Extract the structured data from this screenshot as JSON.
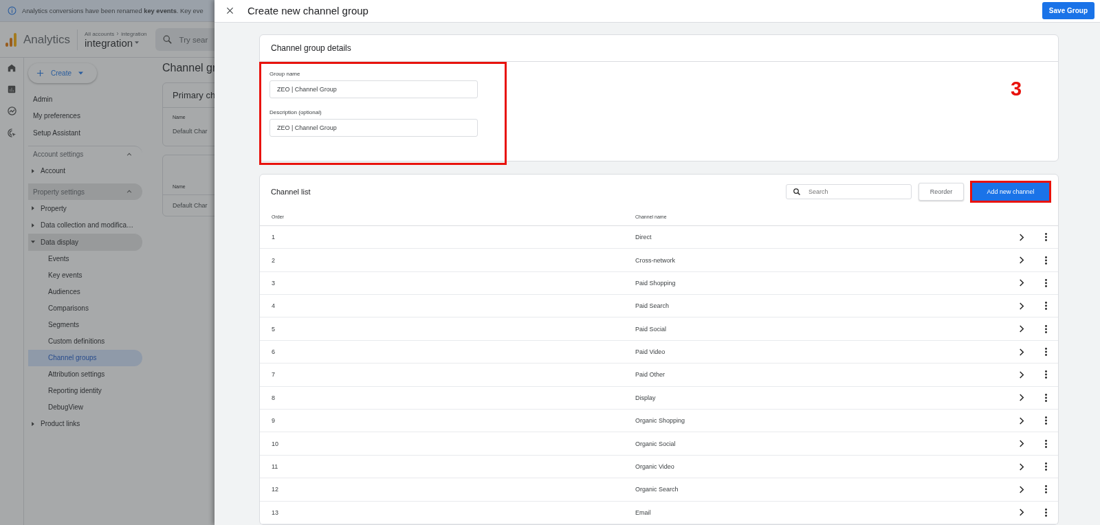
{
  "banner": {
    "text": "Analytics conversions have been renamed **key events**. Key eve"
  },
  "app": {
    "name": "Analytics",
    "breadcrumb": [
      "All accounts",
      "integration"
    ],
    "property": "integration",
    "search_placeholder": "Try sear"
  },
  "rail": [
    {
      "kind": "home"
    },
    {
      "kind": "reports"
    },
    {
      "kind": "explore"
    },
    {
      "kind": "advertising"
    }
  ],
  "create_button": "Create",
  "nav": {
    "links": [
      "Admin",
      "My preferences",
      "Setup Assistant"
    ],
    "sections": [
      {
        "title": "Account settings",
        "expanded": true,
        "selected": false,
        "items": [
          {
            "label": "Account",
            "expanded": false,
            "selected": false
          }
        ]
      },
      {
        "title": "Property settings",
        "expanded": true,
        "selected": true,
        "items": [
          {
            "label": "Property",
            "expanded": false,
            "selected": false
          },
          {
            "label": "Data collection and modifica…",
            "expanded": false,
            "selected": false
          },
          {
            "label": "Data display",
            "expanded": true,
            "selected": true,
            "children": [
              {
                "label": "Events",
                "selected": false
              },
              {
                "label": "Key events",
                "selected": false
              },
              {
                "label": "Audiences",
                "selected": false
              },
              {
                "label": "Comparisons",
                "selected": false
              },
              {
                "label": "Segments",
                "selected": false
              },
              {
                "label": "Custom definitions",
                "selected": false
              },
              {
                "label": "Channel groups",
                "selected": true
              },
              {
                "label": "Attribution settings",
                "selected": false
              },
              {
                "label": "Reporting identity",
                "selected": false
              },
              {
                "label": "DebugView",
                "selected": false
              }
            ]
          },
          {
            "label": "Product links",
            "expanded": false,
            "selected": false
          }
        ]
      }
    ]
  },
  "main": {
    "title": "Channel gr",
    "cards": [
      {
        "title": "Primary ch",
        "column": "Name",
        "row": "Default Char"
      },
      {
        "column": "Name",
        "row": "Default Char"
      }
    ]
  },
  "drawer": {
    "title": "Create new channel group",
    "save_button": "Save Group",
    "details": {
      "title": "Channel group details",
      "highlighted": true,
      "fields": [
        {
          "label": "Group name",
          "value": "ZEO | Channel Group"
        },
        {
          "label": "Description (optional)",
          "value": "ZEO | Channel Group"
        }
      ]
    },
    "annotation": "3",
    "channel_list": {
      "title": "Channel list",
      "search_placeholder": "Search",
      "reorder_button": "Reorder",
      "add_button": {
        "label": "Add new channel",
        "highlighted": true
      },
      "columns": [
        "Order",
        "Channel name"
      ],
      "rows": [
        {
          "order": "1",
          "name": "Direct"
        },
        {
          "order": "2",
          "name": "Cross-network"
        },
        {
          "order": "3",
          "name": "Paid Shopping"
        },
        {
          "order": "4",
          "name": "Paid Search"
        },
        {
          "order": "5",
          "name": "Paid Social"
        },
        {
          "order": "6",
          "name": "Paid Video"
        },
        {
          "order": "7",
          "name": "Paid Other"
        },
        {
          "order": "8",
          "name": "Display"
        },
        {
          "order": "9",
          "name": "Organic Shopping"
        },
        {
          "order": "10",
          "name": "Organic Social"
        },
        {
          "order": "11",
          "name": "Organic Video"
        },
        {
          "order": "12",
          "name": "Organic Search"
        },
        {
          "order": "13",
          "name": "Email"
        }
      ]
    }
  }
}
